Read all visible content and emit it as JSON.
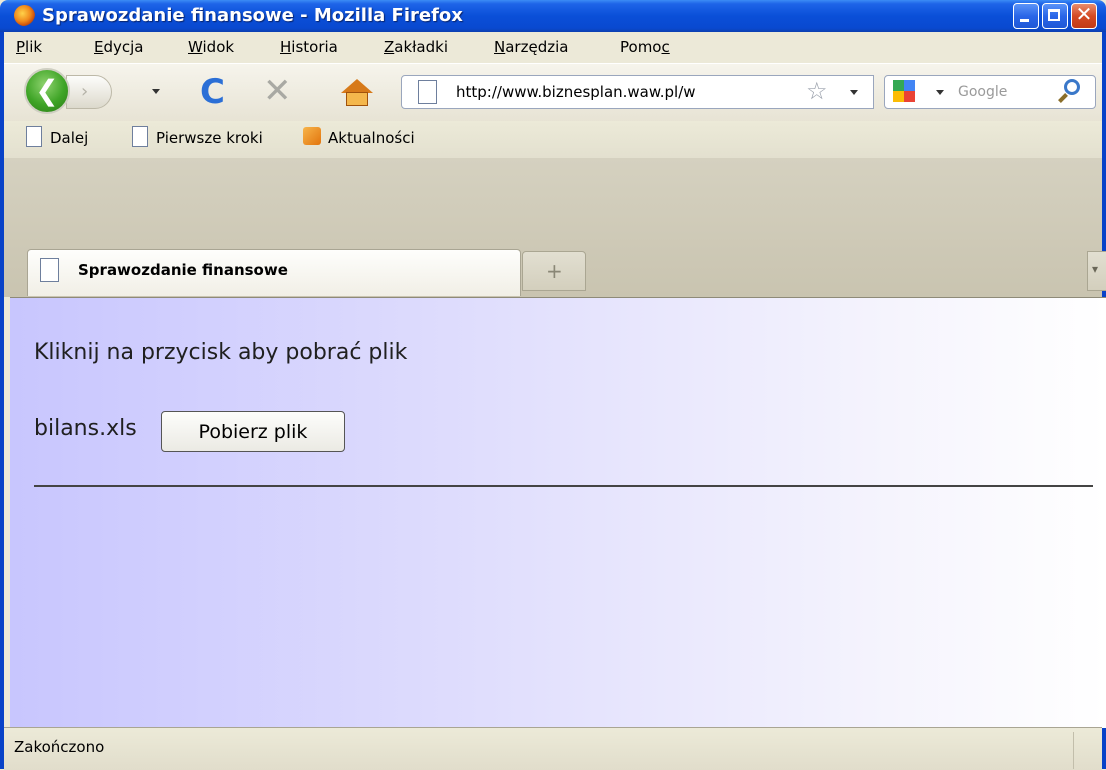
{
  "window": {
    "title": "Sprawozdanie finansowe - Mozilla Firefox",
    "close_glyph": "✕"
  },
  "menu": {
    "items": [
      {
        "label": "Plik",
        "accel": "P"
      },
      {
        "label": "Edycja",
        "accel": "E"
      },
      {
        "label": "Widok",
        "accel": "W"
      },
      {
        "label": "Historia",
        "accel": "H"
      },
      {
        "label": "Zakładki",
        "accel": "Z"
      },
      {
        "label": "Narzędzia",
        "accel": "N"
      },
      {
        "label": "Pomoc",
        "accel": "c"
      }
    ]
  },
  "toolbar": {
    "back_glyph": "❮",
    "forward_glyph": "›",
    "reload_glyph": "C",
    "stop_glyph": "✕",
    "star_glyph": "☆"
  },
  "urlbar": {
    "value": "http://www.biznesplan.waw.pl/w"
  },
  "search": {
    "placeholder": "Google"
  },
  "bookmarks": [
    {
      "label": "Dalej",
      "icon": "page-icon"
    },
    {
      "label": "Pierwsze kroki",
      "icon": "page-icon"
    },
    {
      "label": "Aktualności",
      "icon": "rss-icon"
    }
  ],
  "tabs": {
    "active_label": "Sprawozdanie finansowe",
    "new_tab_glyph": "+",
    "list_glyph": "▾"
  },
  "page": {
    "instruction": "Kliknij na przycisk aby pobrać plik",
    "file_name": "bilans.xls",
    "download_button": "Pobierz plik"
  },
  "status": {
    "text": "Zakończono"
  },
  "colors": {
    "titlebar": "#0a4fd8",
    "content_gradient_start": "#c8c6fe",
    "content_gradient_end": "#ffffff"
  }
}
